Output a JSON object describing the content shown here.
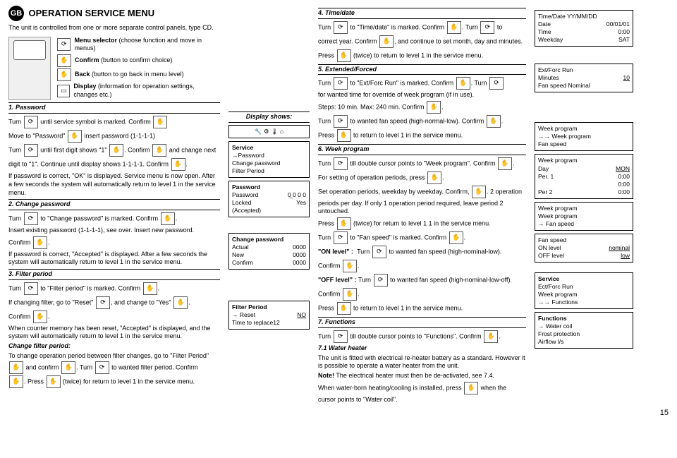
{
  "page_number": "15",
  "badge": "GB",
  "title": "OPERATION SERVICE MENU",
  "intro": "The unit is controlled from one or more separate control panels, type CD.",
  "selectors": {
    "menu": "Menu selector (choose function and move in menus)",
    "confirm": "Confirm (button to confirm choice)",
    "back": "Back (button to go back in menu level)",
    "display": "Display (information for operation settings, changes etc.)"
  },
  "display_shows": "Display shows:",
  "s1": {
    "h": "1.  Password",
    "l1a": "Turn",
    "l1b": "until service symbol is marked. Confirm",
    "l2a": "Move to \"Password\"",
    "l2b": "insert password (1-1-1-1)",
    "l3a": "Turn",
    "l3b": "until first digit shows \"1\"",
    "l3c": ". Confirm",
    "l3d": "and change next",
    "l4": "digit to \"1\". Continue until display shows 1-1-1-1. Confirm",
    "l5": "If password is correct, \"OK\" is displayed. Service menu is now open. After a few seconds the system will automatically return to level 1 in the service menu."
  },
  "d1a": {
    "t": "Service",
    "r1": "→Password",
    "r2": "   Change password",
    "r3": "   Filter Period"
  },
  "d1b": {
    "t": "Password",
    "r1k": "Password",
    "r1v": "0̲ 0 0 0",
    "r2k": "Locked",
    "r2v": "Yes",
    "r3": "(Accepted)"
  },
  "s2": {
    "h": "2.  Change password",
    "l1a": "Turn",
    "l1b": "to \"Change password\" is marked. Confirm",
    "l2": "Insert existing password (1-1-1-1), see over. Insert new password.",
    "l3a": "Confirm",
    "l3b": "If password is correct, \"Accepted\" is displayed. After a few seconds the system will automatically return to level 1 in the service menu."
  },
  "d2": {
    "t": "Change password",
    "r1k": "Actual",
    "r1v": "0000",
    "r2k": "New",
    "r2v": "0000",
    "r3k": "Confirm",
    "r3v": "0000"
  },
  "s3": {
    "h": "3.  Filter period",
    "l1a": "Turn",
    "l1b": "to \"Filter period\" is marked. Confirm",
    "l2a": "If changing filter, go to \"Reset\"",
    "l2b": ", and change to \"Yes\"",
    "l3a": "Confirm",
    "l3b": "When counter memory has been reset, \"Accepted\" is displayed, and the system will automatically return to level 1 in the service menu.",
    "cfp": "Change filter period:",
    "l4": "To change operation period between filter changes, go to \"Filter Period\"",
    "l5a": "and confirm",
    "l5b": ". Turn",
    "l5c": "to wanted filter period. Confirm",
    "l6a": ". Press",
    "l6b": "(twice) for return to level 1 in the service menu."
  },
  "d3": {
    "t": "Filter Period",
    "r1k": "→  Reset",
    "r1v": "NO",
    "r2": "    Time to replace12"
  },
  "s4": {
    "h": "4.  Time/date",
    "l1a": "Turn",
    "l1b": "to \"Time/date\" is marked. Confirm",
    "l1c": ". Turn",
    "l1d": "to",
    "l2a": "correct year. Confirm",
    "l2b": ", and continue to set month, day and minutes.",
    "l3a": "Press",
    "l3b": "(twice) to return to level 1 in the service menu."
  },
  "d4": {
    "t": "Time/Date YY/MM/DD",
    "r1k": "Date",
    "r1v": "00/01/01",
    "r2k": "Time",
    "r2v": "0:00",
    "r3k": "Weekday",
    "r3v": "SAT"
  },
  "s5": {
    "h": "5.  Extended/Forced",
    "l1a": "Turn",
    "l1b": "to \"Ext/Forc Run\" is marked. Confirm",
    "l1c": ". Turn",
    "l2": "for wanted time for override of week program (if in use).",
    "l3a": "Steps: 10 min.  Max: 240 min. Confirm",
    "l4a": "Turn",
    "l4b": "to wanted fan speed (high-normal-low). Confirm",
    "l5a": "Press",
    "l5b": "to return to level 1 in the service menu."
  },
  "d5": {
    "t": "Ext/Forc Run",
    "r1k": "Minutes",
    "r1v": "10",
    "r2": "Fan speed Nominal"
  },
  "s6": {
    "h": "6.  Week program",
    "l1a": "Turn",
    "l1b": "till double cursor points to \"Week program\". Confirm",
    "l2a": "For setting of operation periods, press",
    "l3a": "Set operation periods, weekday by weekday.  Confirm,",
    "l3b": ". 2 operation",
    "l3c": "periods per day. If only 1 operation period required, leave period 2 untouched.",
    "l4a": "Press",
    "l4b": "(twice) for return to level 1 1 in the service menu.",
    "l5a": "Turn",
    "l5b": "to \"Fan speed\" is marked. Confirm",
    "on": "\"ON level\" :",
    "on1": "Turn",
    "on2": "to wanted fan speed (high-nominal-low).",
    "onc": "Confirm",
    "off": "\"OFF level\" :",
    "off1": "Turn",
    "off2": "to wanted fan speed (high-nominal-low-off).",
    "offc": "Confirm",
    "l6a": "Press",
    "l6b": "to return to level 1 in the service menu."
  },
  "d6a": {
    "t": "Week program",
    "r1": "→→ Week program",
    "r2": "      Fan speed"
  },
  "d6b": {
    "t": "Week program",
    "r1k": "Day",
    "r1v": "MON",
    "r2k": "Per. 1",
    "r2v": "0:00",
    "r3k": "",
    "r3v": "0:00",
    "r4k": "Per 2",
    "r4v": "0:00"
  },
  "d6c": {
    "t": "Week program",
    "r1": "     Week program",
    "r2": "→  Fan speed"
  },
  "d6d": {
    "t": "Fan speed",
    "r1k": "ON level",
    "r1v": "nominal",
    "r2k": "OFF level",
    "r2v": "low"
  },
  "s7": {
    "h": "7.  Functions",
    "l1a": "Turn",
    "l1b": "till double cursor points to \"Functions\". Confirm",
    "wh": "7.1  Water heater",
    "wt": "The unit is fitted with electrical re-heater battery as a standard. However it is possible to operate a water heater from the unit.",
    "note_b": "Note!",
    "note": "  The electrical heater must then be de-activated, see  7.4.",
    "l2a": "When water-born heating/cooling is installed, press",
    "l2b": "when the",
    "l2c": "cursor points to \"Water coil\"."
  },
  "d7a": {
    "t": "Service",
    "r1": "   Ect/Forc Run",
    "r2": "   Week program",
    "r3": "→→ Functions"
  },
  "d7b": {
    "t": "Functions",
    "r1": "→  Water coil",
    "r2": "   Frost protection",
    "r3": "   Airflow l/s"
  }
}
